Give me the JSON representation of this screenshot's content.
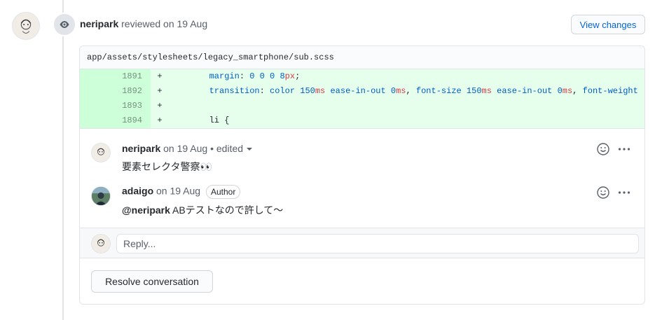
{
  "review": {
    "author": "neripark",
    "action": "reviewed on 19 Aug",
    "view_changes_label": "View changes"
  },
  "file": {
    "path": "app/assets/stylesheets/legacy_smartphone/sub.scss"
  },
  "diff_lines": [
    {
      "line": "1891",
      "sign": "+"
    },
    {
      "line": "1892",
      "sign": "+"
    },
    {
      "line": "1893",
      "sign": "+"
    },
    {
      "line": "1894",
      "sign": "+"
    }
  ],
  "code": {
    "l1_prop": "margin",
    "l1_vals": "0 0 0 8",
    "l1_unit": "px",
    "l2_prop": "transition",
    "l2_a": "color",
    "l2_b": "150",
    "l2_c": "ms",
    "l2_d": "ease-in-out",
    "l2_e": "0",
    "l2_f": "ms",
    "l2_g": "font-size",
    "l2_h": "150",
    "l2_i": "ms",
    "l2_j": "ease-in-out",
    "l2_k": "0",
    "l2_l": "ms",
    "l2_m": "font-weight",
    "l4_sel": "li {"
  },
  "comments": [
    {
      "author": "neripark",
      "meta": "on 19 Aug",
      "edited": "• edited",
      "body": "要素セレクタ警察👀"
    },
    {
      "author": "adaigo",
      "meta": "on 19 Aug",
      "badge": "Author",
      "mention": "@neripark",
      "body": " ABテストなので許して〜"
    }
  ],
  "reply": {
    "placeholder": "Reply..."
  },
  "resolve_label": "Resolve conversation",
  "icons": [
    "eye-icon",
    "smiley-icon",
    "kebab-horizontal-icon",
    "triangle-down-icon"
  ]
}
